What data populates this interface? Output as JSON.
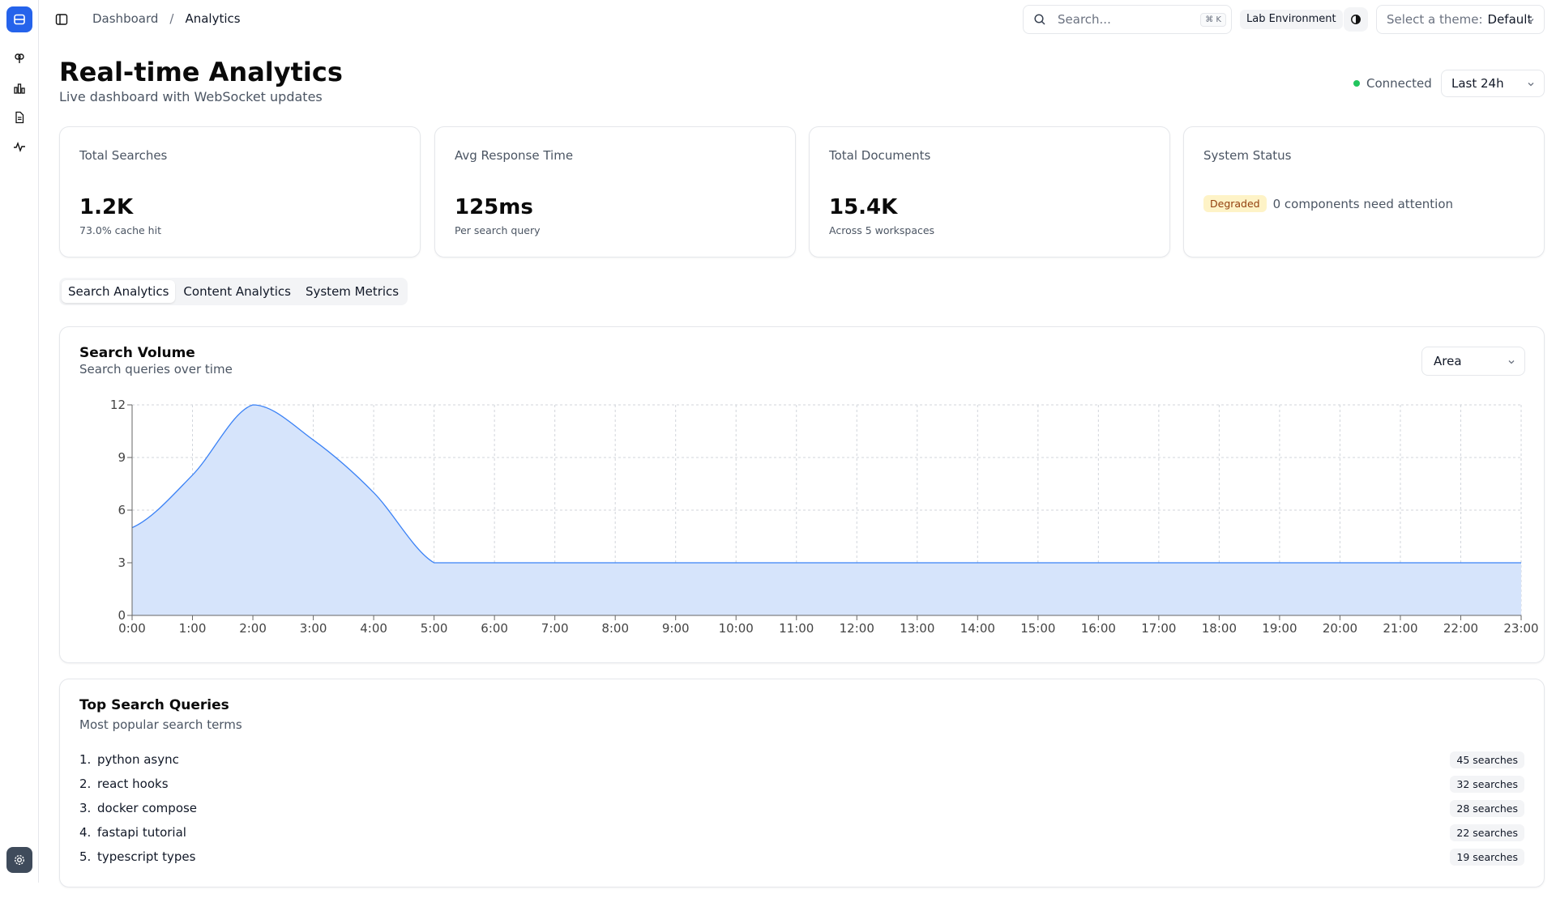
{
  "breadcrumb": {
    "root": "Dashboard",
    "separator": "/",
    "current": "Analytics"
  },
  "search": {
    "placeholder": "Search...",
    "shortcut": "⌘ K"
  },
  "environment": "Lab Environment",
  "theme": {
    "label": "Select a theme:",
    "value": "Default"
  },
  "header": {
    "title": "Real-time Analytics",
    "subtitle": "Live dashboard with WebSocket updates",
    "status": "Connected",
    "range": "Last 24h"
  },
  "stats": [
    {
      "title": "Total Searches",
      "value": "1.2K",
      "note": "73.0% cache hit"
    },
    {
      "title": "Avg Response Time",
      "value": "125ms",
      "note": "Per search query"
    },
    {
      "title": "Total Documents",
      "value": "15.4K",
      "note": "Across 5 workspaces"
    },
    {
      "title": "System Status",
      "badge": "Degraded",
      "note": "0 components need attention"
    }
  ],
  "tabs": [
    "Search Analytics",
    "Content Analytics",
    "System Metrics"
  ],
  "volume_card": {
    "title": "Search Volume",
    "subtitle": "Search queries over time",
    "chart_type": "Area"
  },
  "chart_data": {
    "type": "area",
    "x": [
      "0:00",
      "1:00",
      "2:00",
      "3:00",
      "4:00",
      "5:00",
      "6:00",
      "7:00",
      "8:00",
      "9:00",
      "10:00",
      "11:00",
      "12:00",
      "13:00",
      "14:00",
      "15:00",
      "16:00",
      "17:00",
      "18:00",
      "19:00",
      "20:00",
      "21:00",
      "22:00",
      "23:00"
    ],
    "values": [
      5,
      8,
      12,
      10,
      7,
      3,
      3,
      3,
      3,
      3,
      3,
      3,
      3,
      3,
      3,
      3,
      3,
      3,
      3,
      3,
      3,
      3,
      3,
      3
    ],
    "yticks": [
      0,
      3,
      6,
      9,
      12
    ],
    "ylim": [
      0,
      12
    ],
    "grid": true,
    "color": "#3b82f6",
    "fill": "#d6e4fb"
  },
  "queries_card": {
    "title": "Top Search Queries",
    "subtitle": "Most popular search terms"
  },
  "queries": [
    {
      "rank": "1.",
      "term": "python async",
      "count": "45 searches"
    },
    {
      "rank": "2.",
      "term": "react hooks",
      "count": "32 searches"
    },
    {
      "rank": "3.",
      "term": "docker compose",
      "count": "28 searches"
    },
    {
      "rank": "4.",
      "term": "fastapi tutorial",
      "count": "22 searches"
    },
    {
      "rank": "5.",
      "term": "typescript types",
      "count": "19 searches"
    }
  ]
}
